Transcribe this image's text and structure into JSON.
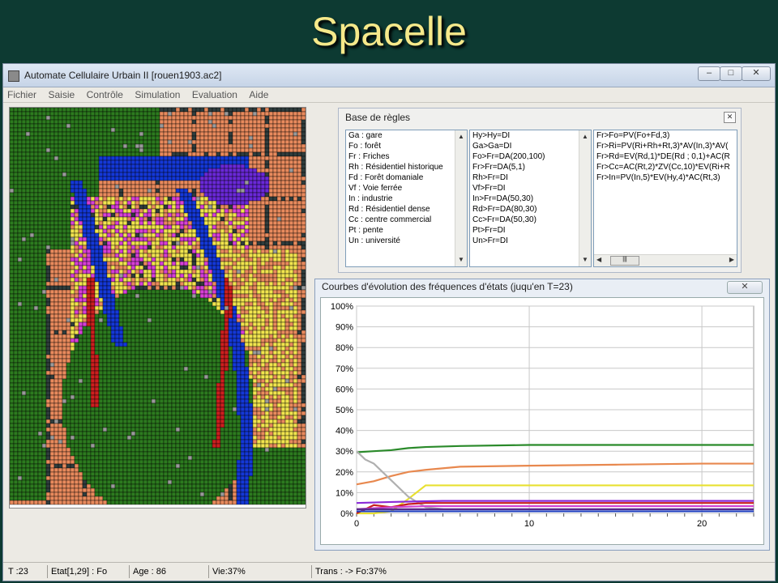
{
  "slide_title": "Spacelle",
  "window": {
    "title": "Automate Cellulaire Urbain II [rouen1903.ac2]",
    "buttons": [
      "–",
      "□",
      "✕"
    ]
  },
  "menu": [
    "Fichier",
    "Saisie",
    "Contrôle",
    "Simulation",
    "Evaluation",
    "Aide"
  ],
  "map_colors": {
    "forest": "#2c7a1f",
    "friche": "#e88a5d",
    "historic": "#d63fd6",
    "dense": "#f0e34e",
    "industry": "#6a28d8",
    "rail": "#cc1f1f",
    "river": "#1438d8",
    "road": "#2f3d3d",
    "gare": "#9a9a9a",
    "other": "#1d5a5a"
  },
  "rules": {
    "title": "Base de règles",
    "close": "✕",
    "legend": [
      "Ga : gare",
      "Fo : forêt",
      "Fr : Friches",
      "Rh : Résidentiel historique",
      "Fd : Forêt domaniale",
      "Vf : Voie ferrée",
      "In : industrie",
      "Rd : Résidentiel dense",
      "Cc : centre commercial",
      "Pt : pente",
      "Un : université"
    ],
    "transitions": [
      "Hy>Hy=DI",
      "Ga>Ga=DI",
      "Fo>Fr=DA(200,100)",
      "Fr>Fr=DA(5,1)",
      "Rh>Fr=DI",
      "Vf>Fr=DI",
      "In>Fr=DA(50,30)",
      "Rd>Fr=DA(80,30)",
      "Cc>Fr=DA(50,30)",
      "Pt>Fr=DI",
      "Un>Fr=DI"
    ],
    "formulas": [
      "Fr>Fo=PV(Fo+Fd,3)",
      "Fr>Ri=PV(Ri+Rh+Rt,3)*AV(In,3)*AV(",
      "Fr>Rd=EV(Rd,1)*DE(Rd ; 0,1)+AC(R",
      "Fr>Cc=AC(Rt,2)*ZV(Cc,10)*EV(Ri+R",
      "Fr>In=PV(In,5)*EV(Hy,4)*AC(Rt,3)"
    ]
  },
  "chart_window": {
    "title": "Courbes d'évolution des fréquences d'états (juqu'en T=23)",
    "close": "✕"
  },
  "chart_data": {
    "type": "line",
    "xlim": [
      0,
      23
    ],
    "ylim": [
      0,
      100
    ],
    "x_ticks": [
      0,
      10,
      20
    ],
    "y_ticks": [
      "0%",
      "10%",
      "20%",
      "30%",
      "40%",
      "50%",
      "60%",
      "70%",
      "80%",
      "90%",
      "100%"
    ],
    "grid": true,
    "series": [
      {
        "color": "#2a8a2a",
        "x": [
          0,
          1,
          2,
          3,
          4,
          6,
          10,
          15,
          20,
          23
        ],
        "y": [
          29.5,
          30,
          30.5,
          31.5,
          32,
          32.5,
          33,
          33,
          33,
          33
        ]
      },
      {
        "color": "#e8884e",
        "x": [
          0,
          1,
          2,
          3,
          4,
          6,
          10,
          15,
          20,
          23
        ],
        "y": [
          14,
          15.5,
          18,
          20,
          21,
          22.5,
          23,
          23.5,
          24,
          24
        ]
      },
      {
        "color": "#e8e030",
        "x": [
          0,
          1,
          2,
          3,
          4,
          10,
          15,
          20,
          23
        ],
        "y": [
          0,
          0,
          1,
          7,
          13.5,
          13.5,
          13.5,
          13.5,
          13.5
        ]
      },
      {
        "color": "#b0b0b0",
        "x": [
          0,
          0.5,
          1,
          2,
          3,
          4,
          5
        ],
        "y": [
          30,
          26,
          24,
          16,
          8,
          3,
          2
        ]
      },
      {
        "color": "#8a2ad8",
        "x": [
          0,
          2,
          5,
          10,
          15,
          20,
          23
        ],
        "y": [
          5,
          5.5,
          6,
          6,
          6,
          6,
          6
        ]
      },
      {
        "color": "#c81e1e",
        "x": [
          0,
          1,
          2,
          3,
          4,
          10,
          15,
          20,
          23
        ],
        "y": [
          0,
          4,
          3,
          4.5,
          5,
          5,
          5,
          5,
          5
        ]
      },
      {
        "color": "#d040d0",
        "x": [
          0,
          2,
          4,
          10,
          15,
          20,
          23
        ],
        "y": [
          2,
          3,
          3.5,
          3.5,
          3.5,
          3.5,
          3.5
        ]
      },
      {
        "color": "#5a2a8a",
        "x": [
          0,
          5,
          10,
          15,
          20,
          23
        ],
        "y": [
          2,
          2,
          2,
          2,
          2,
          2
        ]
      },
      {
        "color": "#2040c0",
        "x": [
          0,
          5,
          10,
          15,
          20,
          23
        ],
        "y": [
          1,
          1,
          1,
          1,
          1,
          1
        ]
      }
    ]
  },
  "status": {
    "t": "T :23",
    "etat": "Etat[1,29] : Fo",
    "age": "Age : 86",
    "vie": "Vie:37%",
    "trans": "Trans :  -> Fo:37%"
  }
}
